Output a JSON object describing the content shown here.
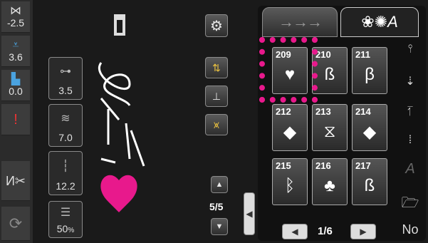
{
  "left_panel": {
    "width_value": "-2.5",
    "length_value": "3.6",
    "presser_value": "0.0"
  },
  "param_panel": {
    "spacing_value": "3.5",
    "tension_value": "7.0",
    "stitch_width_value": "12.2",
    "density_value": "50",
    "density_unit": "%"
  },
  "preview": {
    "page": "5/5"
  },
  "tabs": {
    "tab1_label": "→→→",
    "tab2_label": "A"
  },
  "patterns": [
    {
      "num": "209",
      "glyph": "♥"
    },
    {
      "num": "210",
      "glyph": "ß"
    },
    {
      "num": "211",
      "glyph": "β"
    },
    {
      "num": "212",
      "glyph": "◆"
    },
    {
      "num": "213",
      "glyph": "⧖"
    },
    {
      "num": "214",
      "glyph": "◆"
    },
    {
      "num": "215",
      "glyph": "ᛒ"
    },
    {
      "num": "216",
      "glyph": "♣"
    },
    {
      "num": "217",
      "glyph": "ß"
    }
  ],
  "pattern_page": "1/6",
  "right_sidebar": {
    "no_label": "No",
    "font_label": "A"
  },
  "colors": {
    "accent_pink": "#e8198c",
    "background": "#1a1a1a",
    "blue_icon": "#4aa3e0"
  }
}
